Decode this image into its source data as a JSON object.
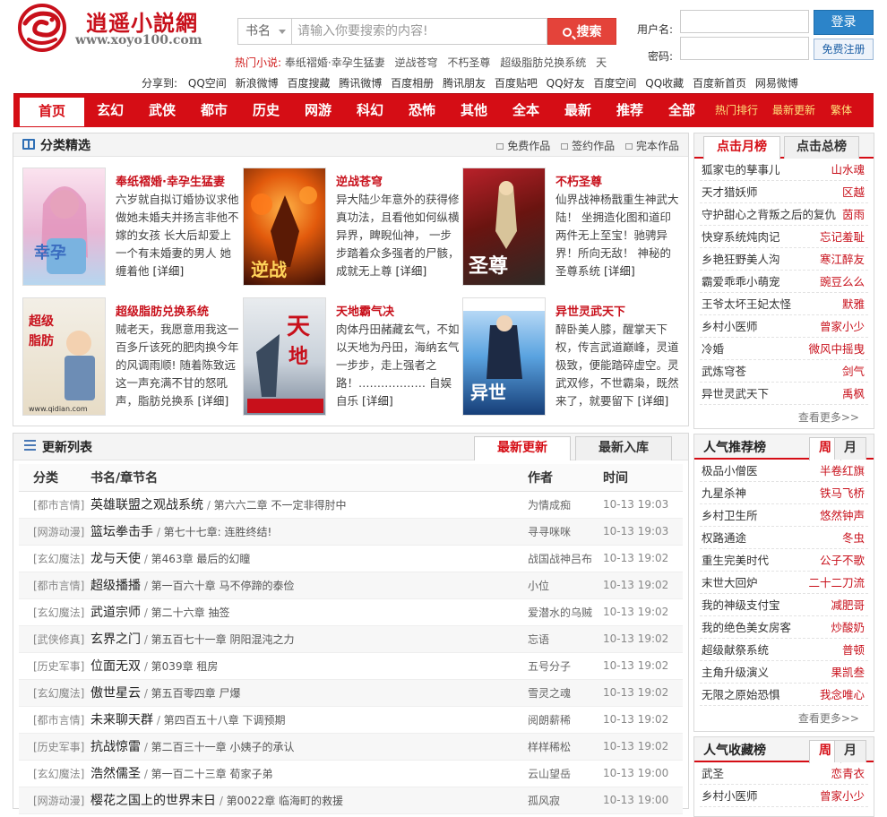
{
  "logo": {
    "name": "逍遥小説網",
    "domain": "www.xoyo100.com"
  },
  "search": {
    "select": "书名",
    "placeholder": "请输入你要搜索的内容!",
    "button": "搜索"
  },
  "hot": {
    "label": "热门小说:",
    "items": [
      "奉纸褶婚·幸孕生猛妻",
      "逆战苍穹",
      "不朽圣尊",
      "超级脂肪兑换系统",
      "天"
    ]
  },
  "share": {
    "label": "分享到:",
    "items": [
      "QQ空间",
      "新浪微博",
      "百度搜藏",
      "腾讯微博",
      "百度相册",
      "腾讯朋友",
      "百度贴吧",
      "QQ好友",
      "百度空间",
      "QQ收藏",
      "百度新首页",
      "网易微博"
    ]
  },
  "login": {
    "user_label": "用户名:",
    "pass_label": "密码:",
    "login_button": "登录",
    "register_button": "免费注册"
  },
  "nav": {
    "items": [
      "首页",
      "玄幻",
      "武侠",
      "都市",
      "历史",
      "网游",
      "科幻",
      "恐怖",
      "其他",
      "全本",
      "最新",
      "推荐",
      "全部"
    ],
    "extra": [
      "热门排行",
      "最新更新",
      "繁体"
    ]
  },
  "featured": {
    "title": "分类精选",
    "tabs": [
      "免费作品",
      "签约作品",
      "完本作品"
    ],
    "detail_label": "[详细]",
    "books": [
      {
        "title": "奉纸褶婚·幸孕生猛妻",
        "desc": "六岁就自拟订婚协议求他做她未婚夫并扬言非他不嫁的女孩 长大后却爱上一个有未婚妻的男人 她缠着他"
      },
      {
        "title": "逆战苍穹",
        "desc": "异大陆少年意外的获得修真功法，且看他如何纵横异界，睥睨仙神， 一步步踏着众多强者的尸骸，成就无上尊"
      },
      {
        "title": "不朽圣尊",
        "desc": "仙界战神杨戬重生神武大陆！ 坐拥造化图和道印两件无上至宝！驰骋异界！所向无敌！ 神秘的圣尊系统"
      },
      {
        "title": "超级脂肪兑换系统",
        "desc": "贼老天，我愿意用我这一百多斤该死的肥肉换今年的风调雨顺! 随着陈致远这一声充满不甘的怒吼声，脂肪兑换系"
      },
      {
        "title": "天地霸气决",
        "desc": "肉体丹田赭藏玄气，不如以天地为丹田，海纳玄气一步步，走上强者之路！……………… 自娱自乐"
      },
      {
        "title": "异世灵武天下",
        "desc": "醉卧美人膝，醒掌天下权，传言武道巅峰，灵道极致，便能踏碎虚空。灵武双修，不世霸枭，既然来了，就要留下"
      }
    ]
  },
  "click_rank": {
    "tabs": [
      "点击月榜",
      "点击总榜"
    ],
    "items": [
      {
        "name": "狐家屯的孳事儿",
        "author": "山水魂"
      },
      {
        "name": "天才猎妖师",
        "author": "区越"
      },
      {
        "name": "守护甜心之背叛之后的复仇",
        "author": "茵雨"
      },
      {
        "name": "快穿系统炖肉记",
        "author": "忘记羞耻"
      },
      {
        "name": "乡艳狂野美人沟",
        "author": "寒江醉友"
      },
      {
        "name": "霸爱乖乖小萌宠",
        "author": "豌豆么么"
      },
      {
        "name": "王爷太坏王妃太怪",
        "author": "默雅"
      },
      {
        "name": "乡村小医师",
        "author": "曾家小少"
      },
      {
        "name": "冷婚",
        "author": "微风中摇曳"
      },
      {
        "name": "武炼穹苍",
        "author": "剑气"
      },
      {
        "name": "异世灵武天下",
        "author": "禹枫"
      }
    ],
    "more": "查看更多>>"
  },
  "popular_rank": {
    "title": "人气推荐榜",
    "tabs": [
      "周",
      "月"
    ],
    "items": [
      {
        "name": "极品小僧医",
        "author": "半卷红旗"
      },
      {
        "name": "九星杀神",
        "author": "铁马飞桥"
      },
      {
        "name": "乡村卫生所",
        "author": "悠然钟声"
      },
      {
        "name": "权路通途",
        "author": "冬虫"
      },
      {
        "name": "重生完美时代",
        "author": "公子不歌"
      },
      {
        "name": "末世大回炉",
        "author": "二十二刀流"
      },
      {
        "name": "我的神级支付宝",
        "author": "减肥哥"
      },
      {
        "name": "我的绝色美女房客",
        "author": "炒酸奶"
      },
      {
        "name": "超级献祭系统",
        "author": "普顿"
      },
      {
        "name": "主角升级演义",
        "author": "果凯叁"
      },
      {
        "name": "无限之原始恐惧",
        "author": "我念唯心"
      }
    ],
    "more": "查看更多>>"
  },
  "fav_rank": {
    "title": "人气收藏榜",
    "tabs": [
      "周",
      "月"
    ],
    "items": [
      {
        "name": "武圣",
        "author": "恋青衣"
      },
      {
        "name": "乡村小医师",
        "author": "曾家小少"
      }
    ]
  },
  "updates": {
    "title": "更新列表",
    "tabs": [
      "最新更新",
      "最新入库"
    ],
    "headers": [
      "分类",
      "书名/章节名",
      "作者",
      "时间"
    ],
    "rows": [
      {
        "cat": "[都市言情]",
        "book": "英雄联盟之观战系统",
        "chapter": "第六六二章 不一定非得肘中",
        "author": "为情成痴",
        "time": "10-13 19:03"
      },
      {
        "cat": "[网游动漫]",
        "book": "篮坛拳击手",
        "chapter": "第七十七章: 连胜终结!",
        "author": "寻寻咪咪",
        "time": "10-13 19:03"
      },
      {
        "cat": "[玄幻魔法]",
        "book": "龙与天使",
        "chapter": "第463章 最后的幻瞳",
        "author": "战国战神吕布",
        "time": "10-13 19:02"
      },
      {
        "cat": "[都市言情]",
        "book": "超级播播",
        "chapter": "第一百六十章 马不停蹄的泰俭",
        "author": "小位",
        "time": "10-13 19:02"
      },
      {
        "cat": "[玄幻魔法]",
        "book": "武道宗师",
        "chapter": "第二十六章 抽签",
        "author": "爱潜水的乌贼",
        "time": "10-13 19:02"
      },
      {
        "cat": "[武侠修真]",
        "book": "玄界之门",
        "chapter": "第五百七十一章 阴阳混沌之力",
        "author": "忘语",
        "time": "10-13 19:02"
      },
      {
        "cat": "[历史军事]",
        "book": "位面无双",
        "chapter": "第039章 租房",
        "author": "五号分子",
        "time": "10-13 19:02"
      },
      {
        "cat": "[玄幻魔法]",
        "book": "傲世星云",
        "chapter": "第五百零四章 尸爆",
        "author": "雪灵之魂",
        "time": "10-13 19:02"
      },
      {
        "cat": "[都市言情]",
        "book": "未来聊天群",
        "chapter": "第四百五十八章 下调预期",
        "author": "阅朗薪稀",
        "time": "10-13 19:02"
      },
      {
        "cat": "[历史军事]",
        "book": "抗战惊雷",
        "chapter": "第二百三十一章 小姨子的承认",
        "author": "样样稀松",
        "time": "10-13 19:02"
      },
      {
        "cat": "[玄幻魔法]",
        "book": "浩然儒圣",
        "chapter": "第一百二十三章 荀家子弟",
        "author": "云山望岳",
        "time": "10-13 19:00"
      },
      {
        "cat": "[网游动漫]",
        "book": "樱花之国上的世界末日",
        "chapter": "第0022章 临海町的救援",
        "author": "孤风寂",
        "time": "10-13 19:00"
      }
    ]
  }
}
